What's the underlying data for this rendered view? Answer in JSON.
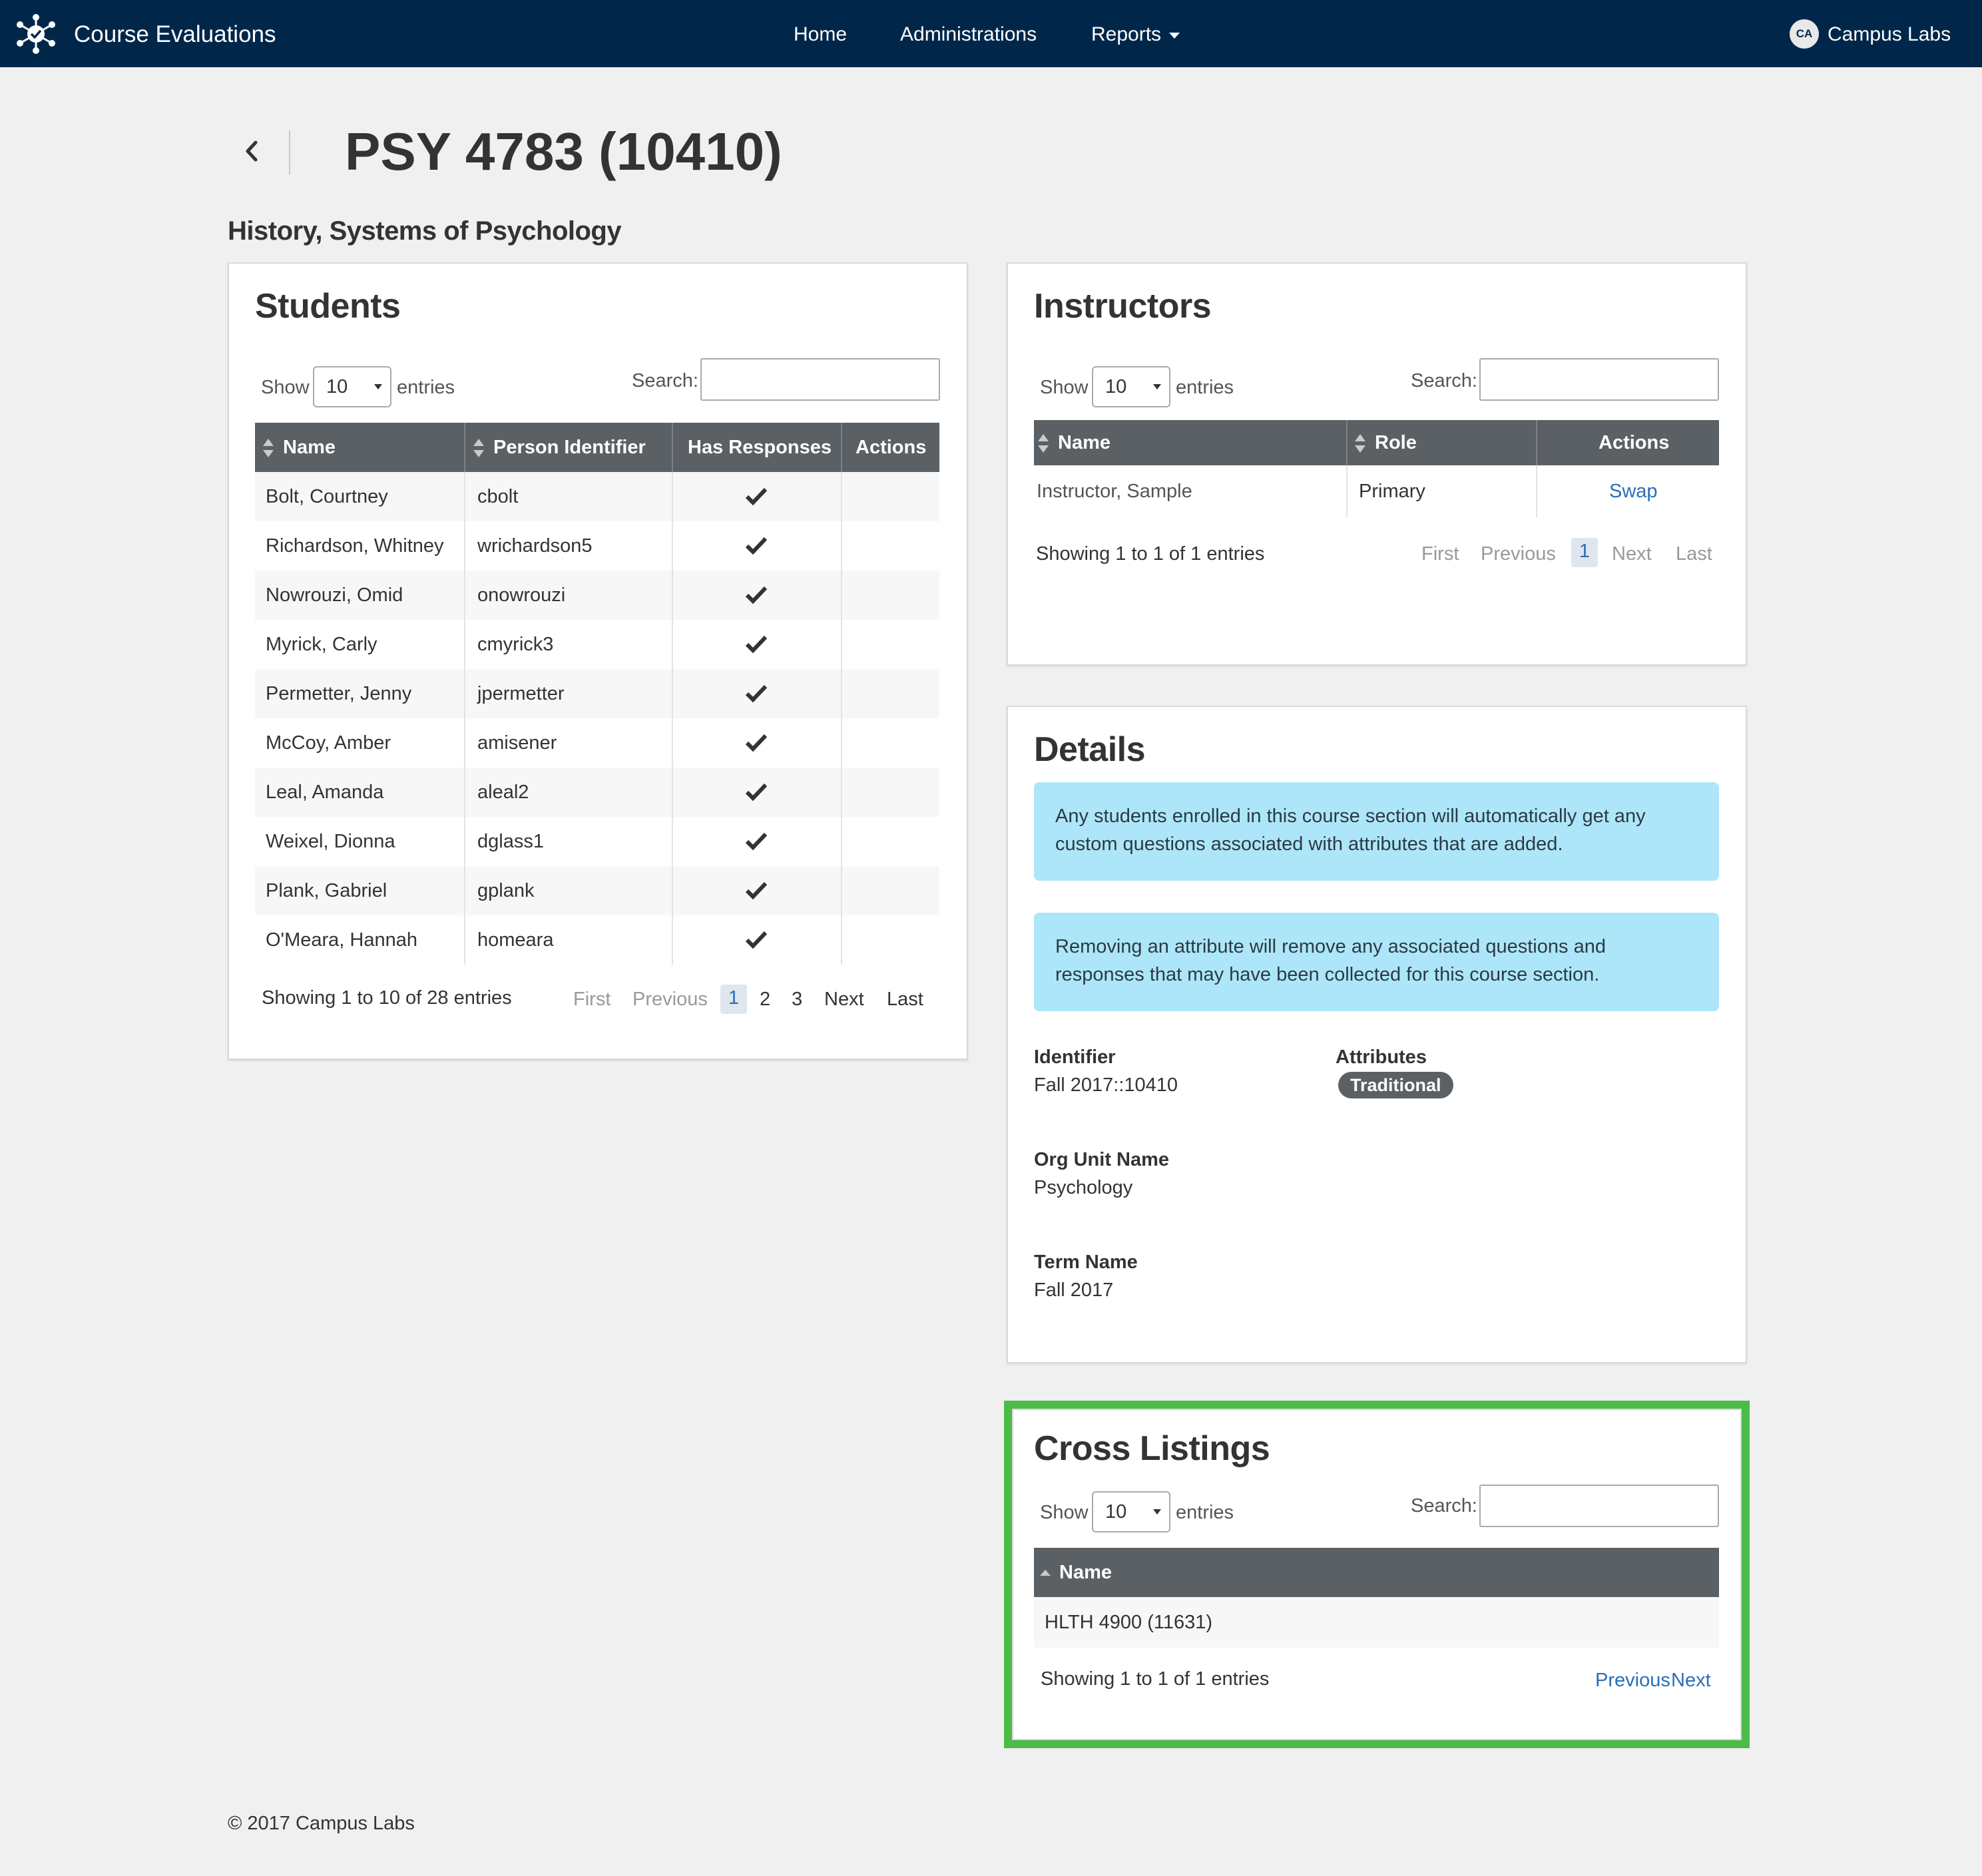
{
  "navbar": {
    "brand": "Course Evaluations",
    "links": [
      "Home",
      "Administrations",
      "Reports"
    ],
    "user_initials": "CA",
    "user_name": "Campus Labs"
  },
  "page": {
    "title": "PSY 4783 (10410)",
    "course_name": "History, Systems of Psychology"
  },
  "students": {
    "title": "Students",
    "show_label": "Show",
    "entries_label": "entries",
    "page_size": "10",
    "search_label": "Search:",
    "columns": [
      "Name",
      "Person Identifier",
      "Has Responses",
      "Actions"
    ],
    "rows": [
      {
        "name": "Bolt, Courtney",
        "id": "cbolt",
        "has_responses": true
      },
      {
        "name": "Richardson, Whitney",
        "id": "wrichardson5",
        "has_responses": true
      },
      {
        "name": "Nowrouzi, Omid",
        "id": "onowrouzi",
        "has_responses": true
      },
      {
        "name": "Myrick, Carly",
        "id": "cmyrick3",
        "has_responses": true
      },
      {
        "name": "Permetter, Jenny",
        "id": "jpermetter",
        "has_responses": true
      },
      {
        "name": "McCoy, Amber",
        "id": "amisener",
        "has_responses": true
      },
      {
        "name": "Leal, Amanda",
        "id": "aleal2",
        "has_responses": true
      },
      {
        "name": "Weixel, Dionna",
        "id": "dglass1",
        "has_responses": true
      },
      {
        "name": "Plank, Gabriel",
        "id": "gplank",
        "has_responses": true
      },
      {
        "name": "O'Meara, Hannah",
        "id": "homeara",
        "has_responses": true
      }
    ],
    "info": "Showing 1 to 10 of 28 entries",
    "pager": {
      "first": "First",
      "previous": "Previous",
      "pages": [
        "1",
        "2",
        "3"
      ],
      "next": "Next",
      "last": "Last"
    }
  },
  "instructors": {
    "title": "Instructors",
    "show_label": "Show",
    "entries_label": "entries",
    "page_size": "10",
    "search_label": "Search:",
    "columns": [
      "Name",
      "Role",
      "Actions"
    ],
    "rows": [
      {
        "name": "Instructor, Sample",
        "role": "Primary",
        "action": "Swap"
      }
    ],
    "info": "Showing 1 to 1 of 1 entries",
    "pager": {
      "first": "First",
      "previous": "Previous",
      "pages": [
        "1"
      ],
      "next": "Next",
      "last": "Last"
    }
  },
  "details": {
    "title": "Details",
    "alert1": "Any students enrolled in this course section will automatically get any custom questions associated with attributes that are added.",
    "alert2": "Removing an attribute will remove any associated questions and responses that may have been collected for this course section.",
    "identifier_label": "Identifier",
    "identifier_value": "Fall 2017::10410",
    "attributes_label": "Attributes",
    "attribute_tag": "Traditional",
    "org_unit_label": "Org Unit Name",
    "org_unit_value": "Psychology",
    "term_label": "Term Name",
    "term_value": "Fall 2017"
  },
  "cross_listings": {
    "title": "Cross Listings",
    "show_label": "Show",
    "entries_label": "entries",
    "page_size": "10",
    "search_label": "Search:",
    "columns": [
      "Name"
    ],
    "rows": [
      {
        "name": "HLTH 4900 (11631)"
      }
    ],
    "info": "Showing 1 to 1 of 1 entries",
    "pager": {
      "previous": "Previous",
      "next": "Next"
    }
  },
  "footer": "© 2017 Campus Labs",
  "colors": {
    "navbar": "#00274a",
    "table_header": "#5b6064",
    "alert": "#ade6f8",
    "highlight": "#4cbb47",
    "link": "#2a6ebb"
  }
}
